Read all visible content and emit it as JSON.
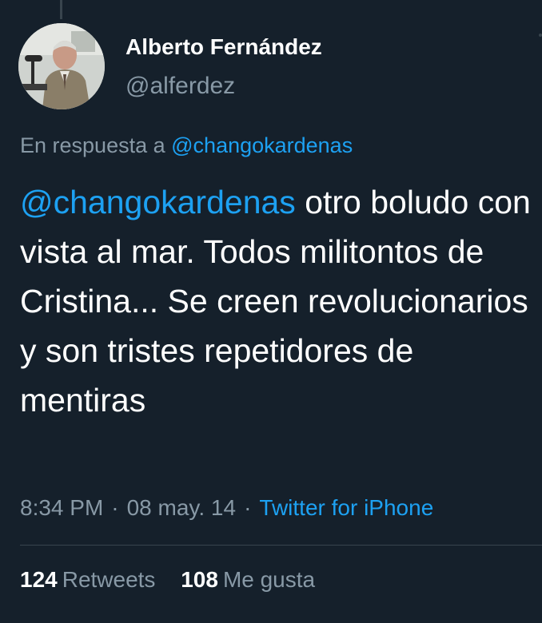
{
  "tweet": {
    "author": {
      "display_name": "Alberto Fernández",
      "handle": "@alferdez"
    },
    "reply_prefix": "En respuesta a",
    "reply_to": "@changokardenas",
    "text_mention": "@changokardenas",
    "text_body": " otro boludo con vista al mar. Todos militontos de Cristina... Se creen revolucionarios y son tristes repetidores de mentiras",
    "time": "8:34 PM",
    "date": "08 may. 14",
    "separator": "·",
    "source": "Twitter for iPhone",
    "retweets_count": "124",
    "retweets_label": "Retweets",
    "likes_count": "108",
    "likes_label": "Me gusta"
  },
  "colors": {
    "background": "#15202b",
    "text": "#ffffff",
    "secondary": "#8899a6",
    "link": "#1da1f2",
    "divider": "#38444d"
  },
  "icons": {
    "more": "more-icon",
    "thread": "thread-line"
  }
}
